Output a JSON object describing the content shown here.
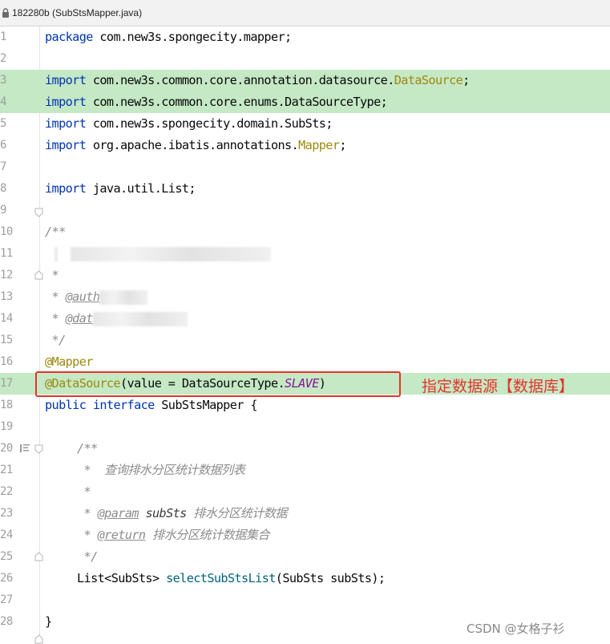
{
  "window": {
    "title": "182280b (SubStsMapper.java)"
  },
  "code": {
    "package_kw": "package",
    "package_name": "com.new3s.spongecity.mapper;",
    "import_kw": "import",
    "imports": [
      {
        "prefix": "com.new3s.common.core.annotation.datasource.",
        "symbol": "DataSource",
        "suffix": ";"
      },
      {
        "prefix": "com.new3s.common.core.enums.DataSourceType;",
        "symbol": "",
        "suffix": ""
      },
      {
        "prefix": "com.new3s.spongecity.domain.SubSts;",
        "symbol": "",
        "suffix": ""
      },
      {
        "prefix": "org.apache.ibatis.annotations.",
        "symbol": "Mapper",
        "suffix": ";"
      },
      {
        "prefix": "java.util.List;",
        "symbol": "",
        "suffix": ""
      }
    ],
    "doc_open": "/**",
    "doc_star": " *",
    "doc_close": " */",
    "doc_author_tag": "@auth",
    "doc_date_tag": "@dat",
    "mapper_annotation": "@Mapper",
    "ds_annotation": "@DataSource",
    "ds_args_open": "(value = DataSourceType.",
    "ds_const": "SLAVE",
    "ds_args_close": ")",
    "public_kw": "public",
    "interface_kw": "interface",
    "interface_name": "SubStsMapper {",
    "method_doc_open": "/**",
    "method_doc_desc": " *  查询排水分区统计数据列表",
    "method_doc_star": " *",
    "method_doc_param_prefix": " * ",
    "method_doc_param_tag": "@param",
    "method_doc_param_name": "subSts",
    "method_doc_param_desc": " 排水分区统计数据",
    "method_doc_return_prefix": " * ",
    "method_doc_return_tag": "@return",
    "method_doc_return_desc": " 排水分区统计数据集合",
    "method_doc_close": " */",
    "method_return": "List<SubSts> ",
    "method_name": "selectSubStsList",
    "method_params": "(SubSts subSts);",
    "closing_brace": "}"
  },
  "line_numbers": [
    "1",
    "2",
    "3",
    "4",
    "5",
    "6",
    "7",
    "8",
    "9",
    "10",
    "11",
    "12",
    "13",
    "14",
    "15",
    "16",
    "17",
    "18",
    "19",
    "20",
    "21",
    "22",
    "23",
    "24",
    "25",
    "26",
    "27",
    "28"
  ],
  "annotation_note": "指定数据源【数据库】",
  "watermark": "CSDN @女格子衫",
  "colors": {
    "highlight": "#c5e8c5",
    "annotation_red": "#e5332a"
  },
  "icons": [
    "lock-icon",
    "fold-marker-icon",
    "bookmark-icon"
  ]
}
